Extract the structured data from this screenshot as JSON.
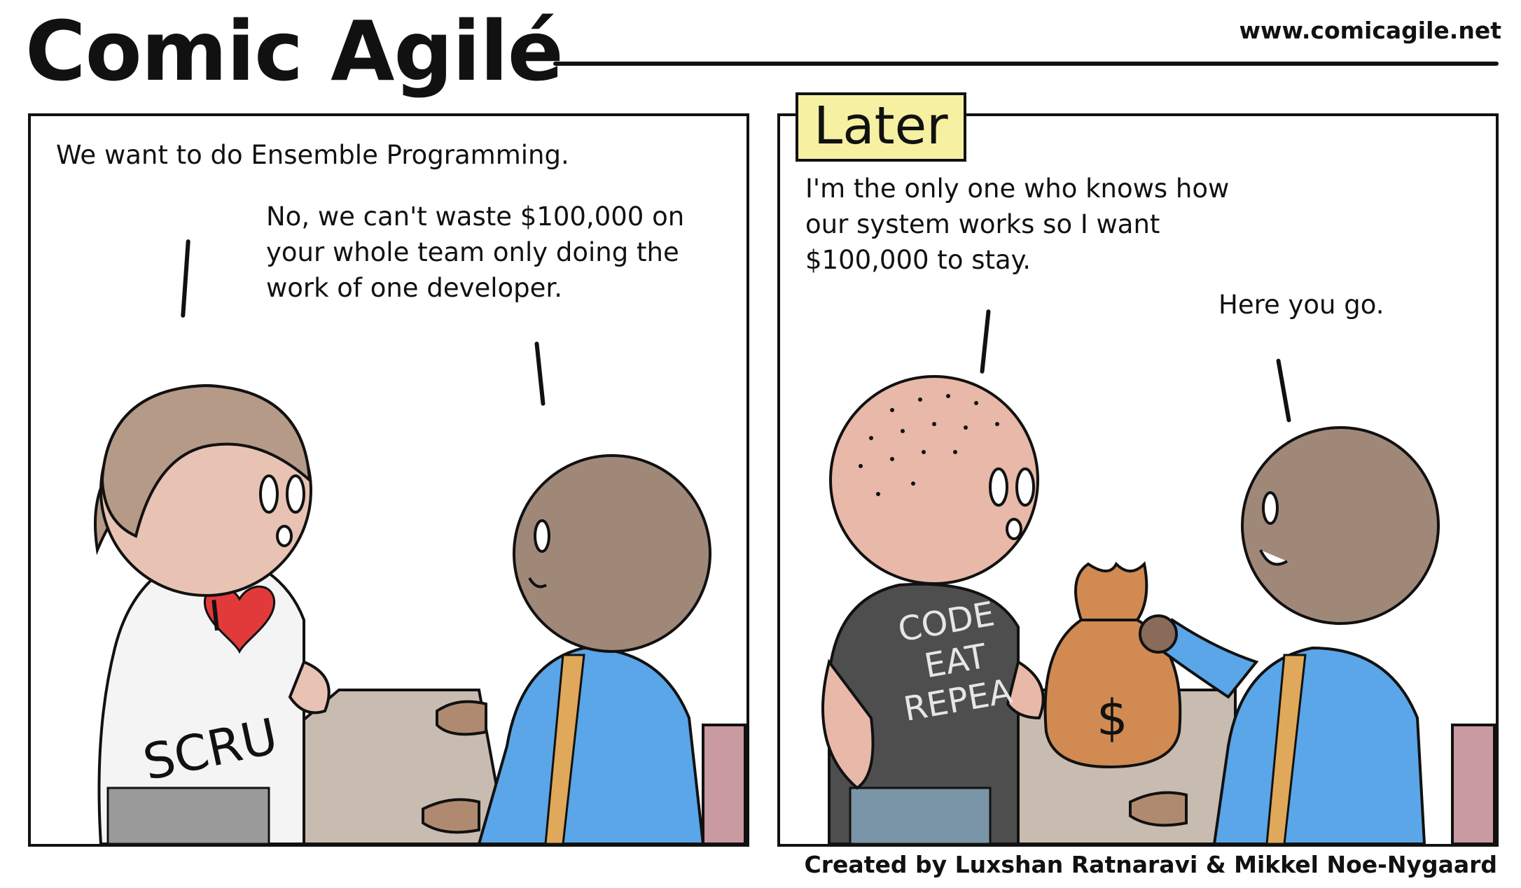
{
  "header": {
    "title": "Comic Agilé",
    "website": "www.comicagile.net"
  },
  "panels": [
    {
      "caption": "",
      "lines": [
        "We want to do Ensemble Programming.",
        "No, we can't waste $100,000 on\nyour whole team only doing the\nwork of one developer."
      ],
      "shirt_text": [
        "I",
        "SCRU"
      ]
    },
    {
      "caption": "Later",
      "lines": [
        "I'm the only one who knows how\nour system works so I want\n$100,000 to stay.",
        "Here you go."
      ],
      "shirt_text": [
        "CODE",
        "EAT",
        "REPEA"
      ],
      "bag_text": "$"
    }
  ],
  "footer": {
    "credit": "Created by Luxshan Ratnaravi & Mikkel Noe-Nygaard"
  },
  "colors": {
    "caption_bg": "#f6f0a2",
    "skin": "#e8b8a8",
    "hair": "#b59a87",
    "shirt_blue": "#5aa6e8",
    "table": "#c8bcb0",
    "bag": "#d08a52",
    "heart": "#e23a3a"
  }
}
